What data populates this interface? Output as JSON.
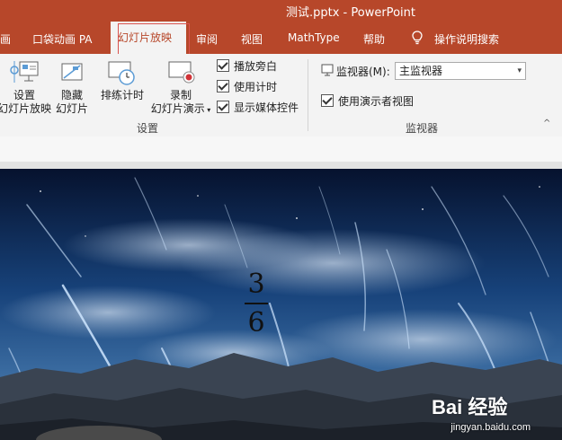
{
  "window": {
    "title": "测试.pptx  -  PowerPoint"
  },
  "tabs": [
    {
      "label": "画",
      "active": false
    },
    {
      "label": "口袋动画 PA",
      "active": false
    },
    {
      "label": "幻灯片放映",
      "active": true
    },
    {
      "label": "审阅",
      "active": false
    },
    {
      "label": "视图",
      "active": false
    },
    {
      "label": "MathType",
      "active": false
    },
    {
      "label": "帮助",
      "active": false
    },
    {
      "label": "操作说明搜索",
      "active": false
    }
  ],
  "ribbon": {
    "setup": {
      "setup_show": {
        "line1": "设置",
        "line2": "幻灯片放映"
      },
      "hide_slide": {
        "line1": "隐藏",
        "line2": "幻灯片"
      },
      "rehearse": {
        "line1": "排练计时"
      },
      "record": {
        "line1": "录制",
        "line2": "幻灯片演示"
      },
      "checks": [
        {
          "label": "播放旁白",
          "checked": true
        },
        {
          "label": "使用计时",
          "checked": true
        },
        {
          "label": "显示媒体控件",
          "checked": true
        }
      ],
      "group_label": "设置"
    },
    "monitors": {
      "monitor_label": "监视器(M):",
      "monitor_value": "主监视器",
      "presenter_view": {
        "label": "使用演示者视图",
        "checked": true
      },
      "group_label": "监视器"
    }
  },
  "slide": {
    "fraction": {
      "numerator": "3",
      "denominator": "6"
    },
    "watermark": {
      "logo": "Bai 经验",
      "url": "jingyan.baidu.com"
    }
  },
  "colors": {
    "accent": "#b7472a",
    "ribbon_bg": "#f3f3f3"
  }
}
